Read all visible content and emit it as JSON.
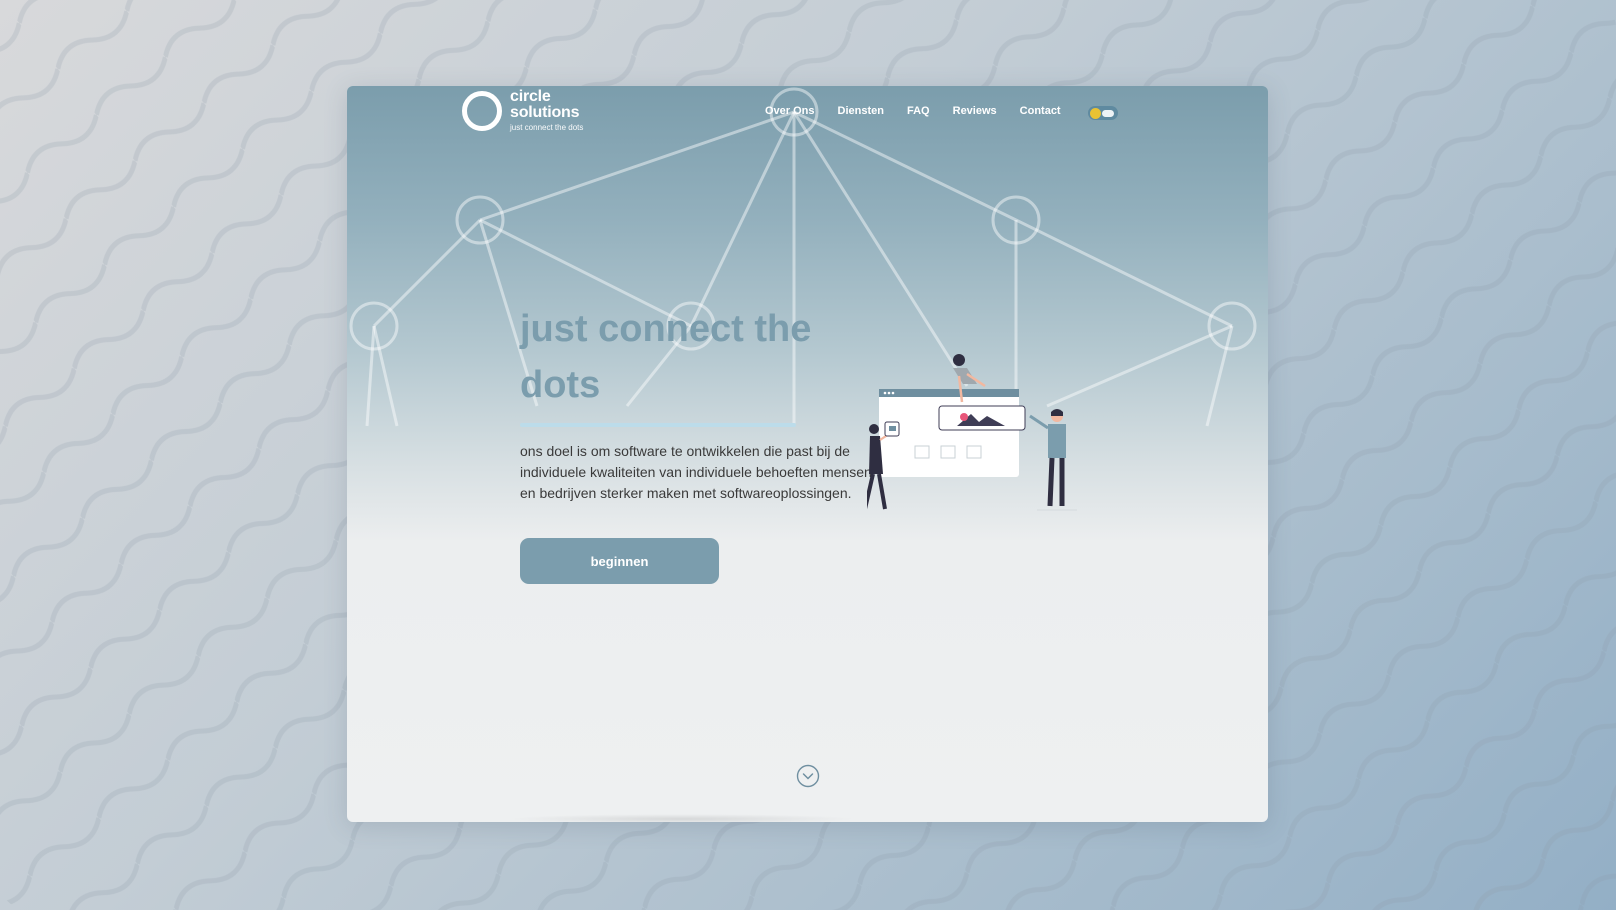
{
  "brand": {
    "name": "circle\nsolutions",
    "name_line1": "circle",
    "name_line2": "solutions",
    "tagline": "just connect the dots",
    "logo_icon": "circle-ring-logo"
  },
  "nav": {
    "items": [
      "Over Ons",
      "Diensten",
      "FAQ",
      "Reviews",
      "Contact"
    ],
    "theme_toggle_icon": "sun-cloud-toggle"
  },
  "hero": {
    "title": "just connect the dots",
    "description": "ons doel is om software te ontwikkelen die past bij de individuele kwaliteiten van individuele behoeften mensen en bedrijven sterker maken met softwareoplossingen.",
    "cta_label": "beginnen",
    "scroll_icon": "chevron-down-circle-icon"
  },
  "colors": {
    "accent": "#7b9dad",
    "underline": "#bcdcea",
    "text": "#3a3a3a",
    "toggle_sun": "#e8c233"
  }
}
